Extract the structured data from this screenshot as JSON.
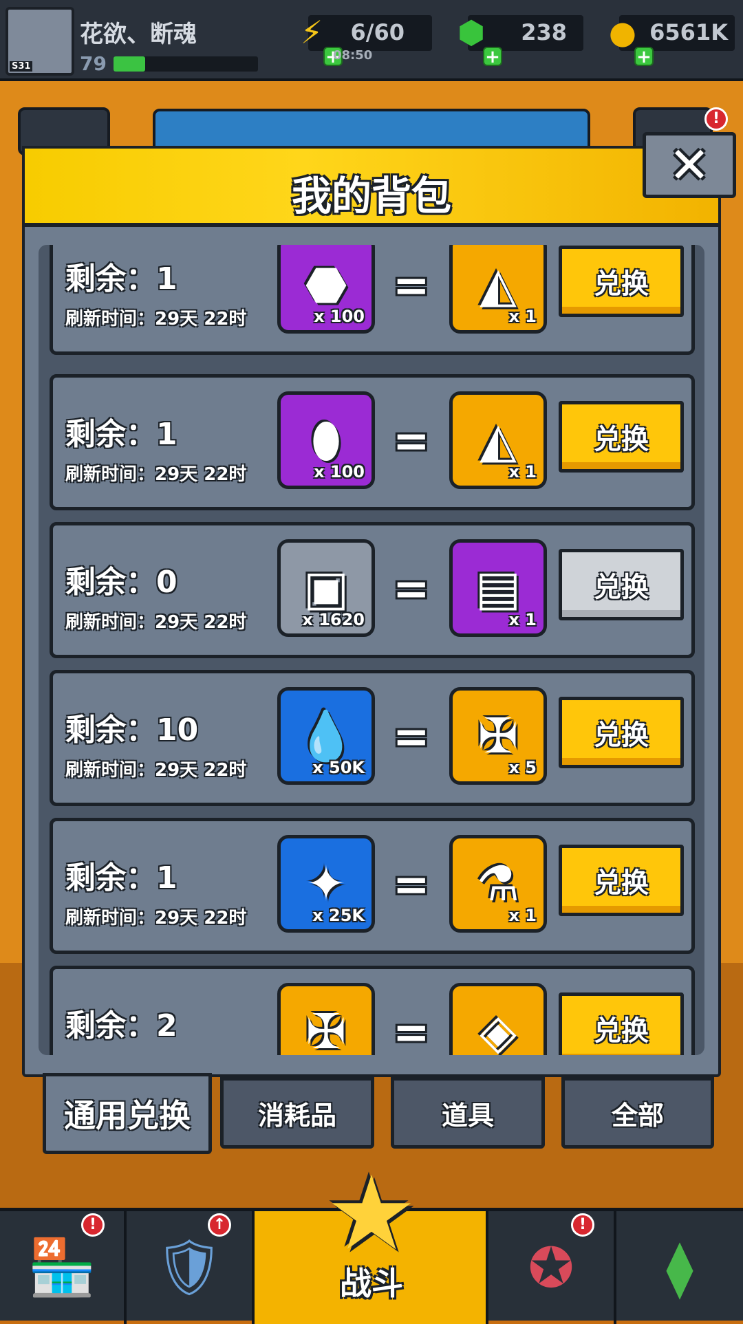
{
  "player": {
    "name": "花欲、断魂",
    "level": "79",
    "avatar_tag": "S31",
    "xp_fraction": 0.22
  },
  "resources": {
    "energy": {
      "value": "6/60",
      "timer": "08:50",
      "icon": "lightning-icon"
    },
    "gems": {
      "value": "238",
      "icon": "green-gem-icon"
    },
    "coins": {
      "value": "6561K",
      "icon": "gold-coin-icon"
    }
  },
  "panel": {
    "title": "我的背包",
    "close_label": "✕"
  },
  "rows": [
    {
      "remaining": "剩余：1",
      "refresh": "刷新时间：29天 22时",
      "cost": {
        "icon": "purple-gem-capsule-icon",
        "qty": "x 100",
        "color": "purple"
      },
      "reward": {
        "icon": "red-prism-shard-icon",
        "qty": "x 1",
        "color": "gold"
      },
      "button": "兑换",
      "enabled": true
    },
    {
      "remaining": "剩余：1",
      "refresh": "刷新时间：29天 22时",
      "cost": {
        "icon": "energy-canister-icon",
        "qty": "x 100",
        "color": "purple"
      },
      "reward": {
        "icon": "red-prism-shard-icon",
        "qty": "x 1",
        "color": "gold"
      },
      "button": "兑换",
      "enabled": true
    },
    {
      "remaining": "剩余：0",
      "refresh": "刷新时间：29天 22时",
      "cost": {
        "icon": "metal-cube-icon",
        "qty": "x 1620",
        "color": "gray"
      },
      "reward": {
        "icon": "purple-s-chest-icon",
        "qty": "x 1",
        "color": "purple"
      },
      "button": "兑换",
      "enabled": false
    },
    {
      "remaining": "剩余：10",
      "refresh": "刷新时间：29天 22时",
      "cost": {
        "icon": "golden-drop-icon",
        "qty": "x 50K",
        "color": "blue"
      },
      "reward": {
        "icon": "s-puzzle-piece-icon",
        "qty": "x 5",
        "color": "gold"
      },
      "button": "兑换",
      "enabled": true
    },
    {
      "remaining": "剩余：1",
      "refresh": "刷新时间：29天 22时",
      "cost": {
        "icon": "blue-puzzle-piece-icon",
        "qty": "x 25K",
        "color": "blue"
      },
      "reward": {
        "icon": "potion-flask-icon",
        "qty": "x 1",
        "color": "gold"
      },
      "button": "兑换",
      "enabled": true
    },
    {
      "remaining": "剩余：2",
      "refresh": "",
      "cost": {
        "icon": "s-puzzle-piece-icon",
        "qty": "",
        "color": "gold"
      },
      "reward": {
        "icon": "crystal-core-icon",
        "qty": "",
        "color": "gold"
      },
      "button": "兑换",
      "enabled": true
    }
  ],
  "tabs": [
    "通用兑换",
    "消耗品",
    "道具",
    "全部"
  ],
  "bottom_nav": {
    "battle_label": "战斗"
  }
}
